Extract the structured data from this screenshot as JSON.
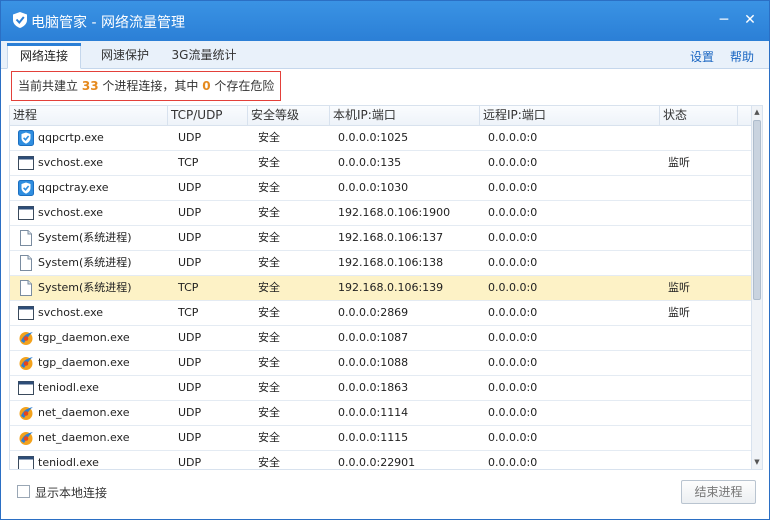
{
  "window": {
    "title": "电脑管家 - 网络流量管理",
    "minimize": "─",
    "close": "✕"
  },
  "tabs": [
    {
      "label": "网络连接",
      "active": true
    },
    {
      "label": "网速保护",
      "active": false
    },
    {
      "label": "3G流量统计",
      "active": false
    }
  ],
  "links": {
    "settings": "设置",
    "help": "帮助"
  },
  "summary": {
    "prefix": "当前共建立",
    "count": "33",
    "middle": "个进程连接，其中",
    "danger": "0",
    "suffix": "个存在危险"
  },
  "columns": [
    "进程",
    "TCP/UDP",
    "安全等级",
    "本机IP:端口",
    "远程IP:端口",
    "状态"
  ],
  "rows": [
    {
      "icon": "shield-icon",
      "name": "qqpcrtp.exe",
      "proto": "UDP",
      "level": "安全",
      "local": "0.0.0.0:1025",
      "remote": "0.0.0.0:0",
      "status": ""
    },
    {
      "icon": "window-icon",
      "name": "svchost.exe",
      "proto": "TCP",
      "level": "安全",
      "local": "0.0.0.0:135",
      "remote": "0.0.0.0:0",
      "status": "监听"
    },
    {
      "icon": "shield-icon",
      "name": "qqpctray.exe",
      "proto": "UDP",
      "level": "安全",
      "local": "0.0.0.0:1030",
      "remote": "0.0.0.0:0",
      "status": ""
    },
    {
      "icon": "window-icon",
      "name": "svchost.exe",
      "proto": "UDP",
      "level": "安全",
      "local": "192.168.0.106:1900",
      "remote": "0.0.0.0:0",
      "status": ""
    },
    {
      "icon": "page-icon",
      "name": "System(系统进程)",
      "proto": "UDP",
      "level": "安全",
      "local": "192.168.0.106:137",
      "remote": "0.0.0.0:0",
      "status": ""
    },
    {
      "icon": "page-icon",
      "name": "System(系统进程)",
      "proto": "UDP",
      "level": "安全",
      "local": "192.168.0.106:138",
      "remote": "0.0.0.0:0",
      "status": ""
    },
    {
      "icon": "page-icon",
      "name": "System(系统进程)",
      "proto": "TCP",
      "level": "安全",
      "local": "192.168.0.106:139",
      "remote": "0.0.0.0:0",
      "status": "监听",
      "selected": true
    },
    {
      "icon": "window-icon",
      "name": "svchost.exe",
      "proto": "TCP",
      "level": "安全",
      "local": "0.0.0.0:2869",
      "remote": "0.0.0.0:0",
      "status": "监听"
    },
    {
      "icon": "tgp-icon",
      "name": "tgp_daemon.exe",
      "proto": "UDP",
      "level": "安全",
      "local": "0.0.0.0:1087",
      "remote": "0.0.0.0:0",
      "status": ""
    },
    {
      "icon": "tgp-icon",
      "name": "tgp_daemon.exe",
      "proto": "UDP",
      "level": "安全",
      "local": "0.0.0.0:1088",
      "remote": "0.0.0.0:0",
      "status": ""
    },
    {
      "icon": "window-icon",
      "name": "teniodl.exe",
      "proto": "UDP",
      "level": "安全",
      "local": "0.0.0.0:1863",
      "remote": "0.0.0.0:0",
      "status": ""
    },
    {
      "icon": "tgp-icon",
      "name": "net_daemon.exe",
      "proto": "UDP",
      "level": "安全",
      "local": "0.0.0.0:1114",
      "remote": "0.0.0.0:0",
      "status": ""
    },
    {
      "icon": "tgp-icon",
      "name": "net_daemon.exe",
      "proto": "UDP",
      "level": "安全",
      "local": "0.0.0.0:1115",
      "remote": "0.0.0.0:0",
      "status": ""
    },
    {
      "icon": "window-icon",
      "name": "teniodl.exe",
      "proto": "UDP",
      "level": "安全",
      "local": "0.0.0.0:22901",
      "remote": "0.0.0.0:0",
      "status": ""
    }
  ],
  "footer": {
    "show_local": "显示本地连接",
    "end_process": "结束进程"
  }
}
